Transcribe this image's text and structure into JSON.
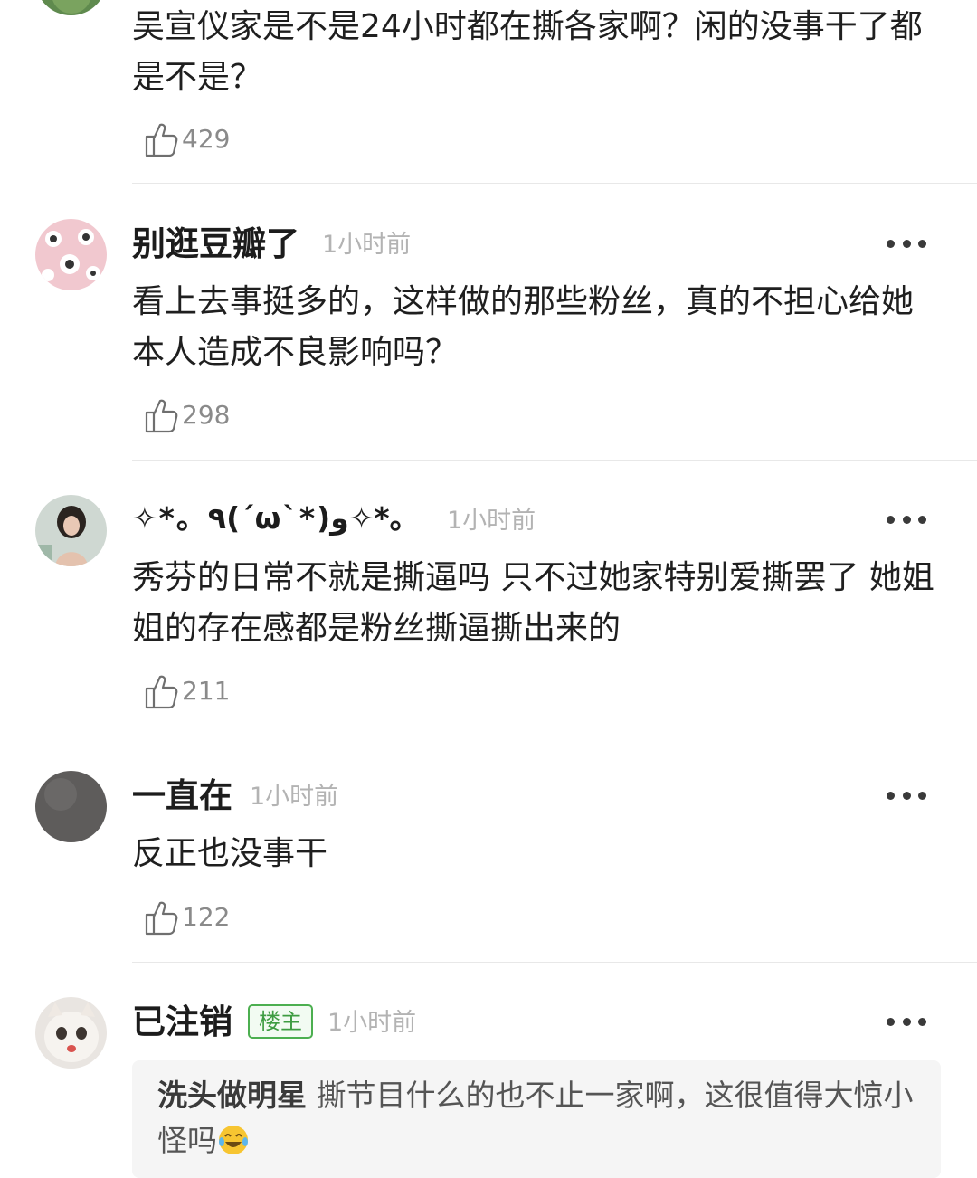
{
  "comments": [
    {
      "content": "吴宣仪家是不是24小时都在撕各家啊？闲的没事干了都是不是？",
      "likes": "429"
    },
    {
      "username": "别逛豆瓣了",
      "time": "1小时前",
      "content": "看上去事挺多的，这样做的那些粉丝，真的不担心给她本人造成不良影响吗？",
      "likes": "298"
    },
    {
      "username": "✧*。٩(ˊωˋ*)و✧*。",
      "time": "1小时前",
      "content": "秀芬的日常不就是撕逼吗 只不过她家特别爱撕罢了 她姐姐的存在感都是粉丝撕逼撕出来的",
      "likes": "211"
    },
    {
      "username": "一直在",
      "time": "1小时前",
      "content": "反正也没事干",
      "likes": "122"
    },
    {
      "username": "已注销",
      "badge": "楼主",
      "time": "1小时前",
      "quote": {
        "name": "洗头做明星",
        "text": " 撕节目什么的也不止一家啊，这很值得大惊小怪吗",
        "emoji": "laughing-tears-emoji"
      }
    }
  ],
  "icons": {
    "like": "thumbs-up-icon",
    "more": "more-dots-icon"
  }
}
